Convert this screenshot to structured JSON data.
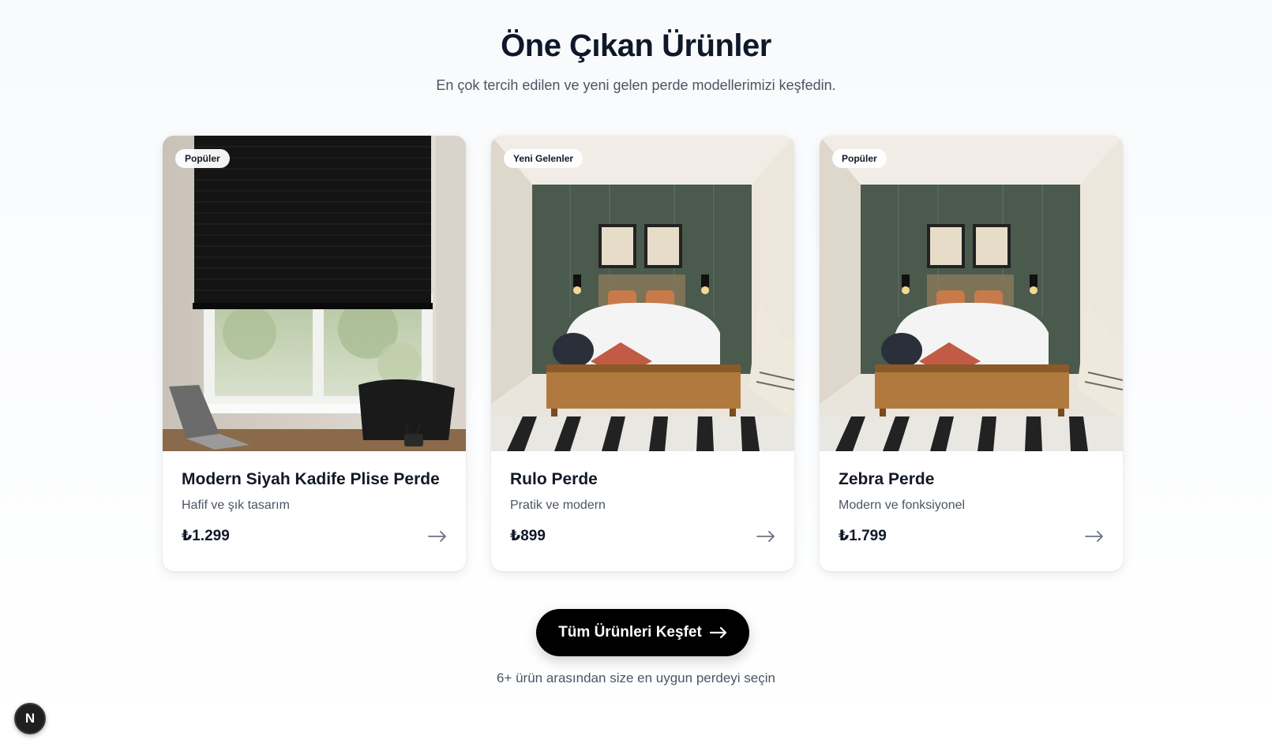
{
  "section": {
    "title": "Öne Çıkan Ürünler",
    "subtitle": "En çok tercih edilen ve yeni gelen perde modellerimizi keşfedin."
  },
  "products": [
    {
      "badge": "Popüler",
      "name": "Modern Siyah Kadife Plise Perde",
      "description": "Hafif ve şık tasarım",
      "price": "₺1.299",
      "image": "black-pleated-blind-office-photo"
    },
    {
      "badge": "Yeni Gelenler",
      "name": "Rulo Perde",
      "description": "Pratik ve modern",
      "price": "₺899",
      "image": "green-bedroom-photo"
    },
    {
      "badge": "Popüler",
      "name": "Zebra Perde",
      "description": "Modern ve fonksiyonel",
      "price": "₺1.799",
      "image": "green-bedroom-photo"
    }
  ],
  "cta": {
    "label": "Tüm Ürünleri Keşfet",
    "note": "6+ ürün arasından size en uygun perdeyi seçin"
  },
  "dev_badge": {
    "label": "N"
  },
  "colors": {
    "accent": "#000000",
    "text_primary": "#111827",
    "text_secondary": "#4b5563",
    "background": "#f8fafc"
  }
}
